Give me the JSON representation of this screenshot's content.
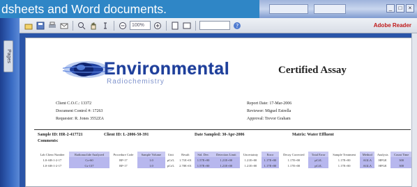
{
  "caption": "dsheets and Word documents.",
  "reader": {
    "sidebar_tab": "Pages",
    "zoom": "100%",
    "find_placeholder": "",
    "adobe_label": "Adobe Reader"
  },
  "document": {
    "brand_title": "Environmental",
    "brand_subtitle": "Radiochemistry",
    "title": "Certified Assay",
    "client_cust": "Client C.O.C.:  13372",
    "received_by": "Document Control #:  17263",
    "requester": "Requester:  R. Jones 3552ZA",
    "report_date": "Report Date:  17-Mar-2006",
    "reviewer": "Reviewer:  Miguel Estrella",
    "approval": "Approval:  Trevor Graham",
    "sample_id": "Sample ID:  HR-2-417721",
    "client_id": "Client ID:  L-2006-50-391",
    "date_sampled": "Date Sampled:  30-Apr-2006",
    "matrix": "Matrix:  Water Effluent",
    "comments": "Comments:"
  },
  "table": {
    "headers": [
      "Lab Client Number",
      "Radionuclide Analyzed",
      "Procedure Code",
      "Sample Volume",
      "Unit",
      "Result",
      "Std. Dev.",
      "Detection Limit",
      "Uncertainty",
      "Error",
      "Decay Corrected",
      "Total Error",
      "Sample Treatment",
      "Method",
      "Analysis",
      "Count Time"
    ],
    "rows": [
      [
        "L0-AB-1-2-17",
        "Co-60",
        "RP-17",
        "1.0",
        "pCi/L",
        "1.71E+01",
        "1.57E+00",
        "1.21E+00",
        "1.21E+00",
        "1.17E+00",
        "1.17E+00",
        "pCi/L",
        "1.17E+00",
        "AGLA",
        "HPGE",
        "300"
      ],
      [
        "L0-AB-1-2-17",
        "Cs-137",
        "RP-17",
        "1.0",
        "pCi/L",
        "2.70E+01",
        "1.57E+00",
        "1.21E+00",
        "1.21E+00",
        "1.17E+00",
        "1.17E+00",
        "pCi/L",
        "1.17E+00",
        "AGLA",
        "HPGE",
        "300"
      ]
    ]
  }
}
